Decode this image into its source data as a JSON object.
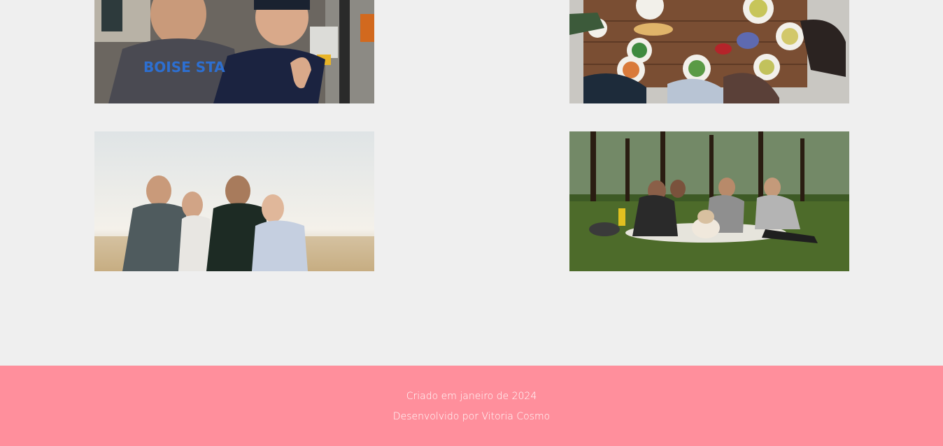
{
  "gallery": {
    "photos": [
      {
        "alt": "Dois amigos sorrindo na rua"
      },
      {
        "alt": "Grupo compartilhando uma refeição à mesa"
      },
      {
        "alt": "Amigos rindo juntos ao ar livre"
      },
      {
        "alt": "Amigos fazendo piquenique no parque com um cachorro"
      }
    ]
  },
  "footer": {
    "line1": "Criado em janeiro de 2024",
    "line2": "Desenvolvido por Vitoria Cosmo"
  },
  "colors": {
    "background": "#efefef",
    "footer_bg": "#ff8f9c",
    "footer_text": "#ffffff"
  }
}
